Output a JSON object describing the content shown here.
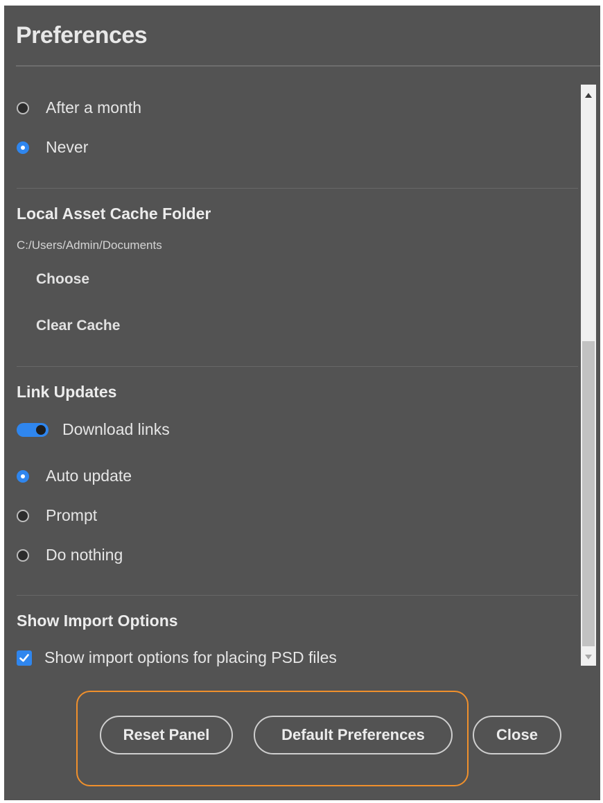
{
  "dialog": {
    "title": "Preferences"
  },
  "purge": {
    "options": [
      {
        "label": "After a month",
        "selected": false
      },
      {
        "label": "Never",
        "selected": true
      }
    ]
  },
  "cache": {
    "heading": "Local Asset Cache Folder",
    "path": "C:/Users/Admin/Documents",
    "choose_label": "Choose",
    "clear_label": "Clear Cache"
  },
  "links": {
    "heading": "Link Updates",
    "download_toggle_label": "Download links",
    "download_toggle_on": true,
    "options": [
      {
        "label": "Auto update",
        "selected": true
      },
      {
        "label": "Prompt",
        "selected": false
      },
      {
        "label": "Do nothing",
        "selected": false
      }
    ]
  },
  "import": {
    "heading": "Show Import Options",
    "checkbox_label": "Show import options for placing PSD files",
    "checked": true
  },
  "footer": {
    "reset_label": "Reset Panel",
    "default_label": "Default Preferences",
    "close_label": "Close"
  },
  "colors": {
    "panel_bg": "#535353",
    "accent": "#2f86ee",
    "highlight": "#f0902c"
  }
}
